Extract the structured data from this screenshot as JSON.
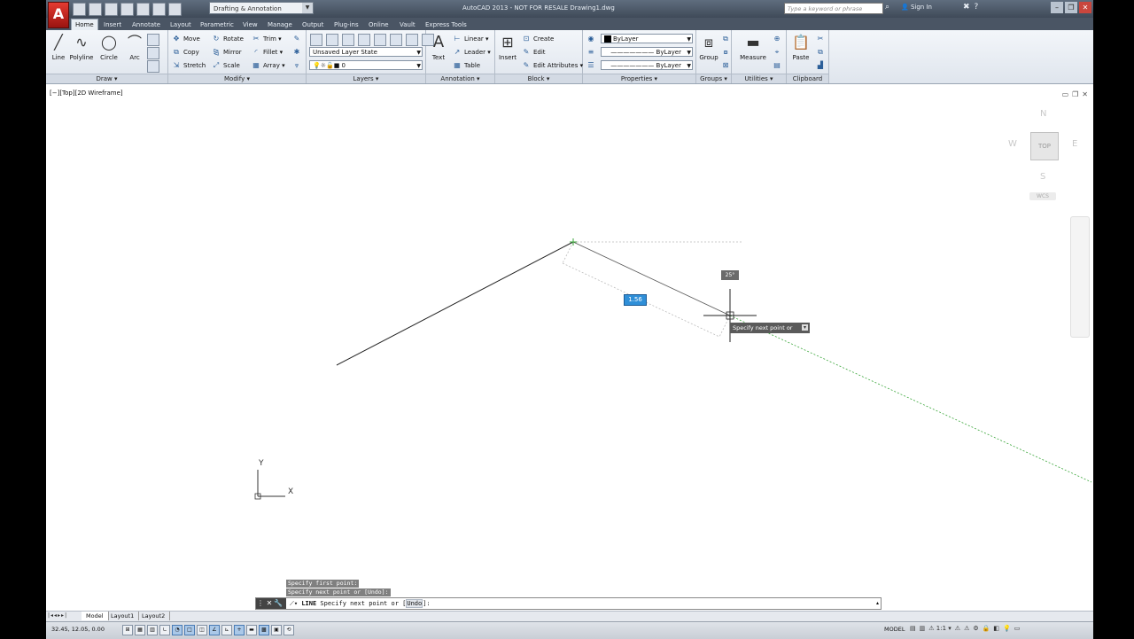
{
  "app": {
    "logo_letter": "A",
    "title": "AutoCAD 2013 - NOT FOR RESALE     Drawing1.dwg",
    "workspace": "Drafting & Annotation",
    "search_placeholder": "Type a keyword or phrase",
    "signin": "Sign In"
  },
  "tabs": [
    "Home",
    "Insert",
    "Annotate",
    "Layout",
    "Parametric",
    "View",
    "Manage",
    "Output",
    "Plug-ins",
    "Online",
    "Vault",
    "Express Tools"
  ],
  "ribbon": {
    "draw": {
      "title": "Draw",
      "line": "Line",
      "polyline": "Polyline",
      "circle": "Circle",
      "arc": "Arc"
    },
    "modify": {
      "title": "Modify",
      "move": "Move",
      "rotate": "Rotate",
      "trim": "Trim",
      "copy": "Copy",
      "mirror": "Mirror",
      "fillet": "Fillet",
      "stretch": "Stretch",
      "scale": "Scale",
      "array": "Array"
    },
    "layers": {
      "title": "Layers",
      "layer_state": "Unsaved Layer State",
      "current_layer": "0"
    },
    "annotation": {
      "title": "Annotation",
      "text": "Text",
      "linear": "Linear",
      "leader": "Leader",
      "table": "Table"
    },
    "block": {
      "title": "Block",
      "insert": "Insert",
      "create": "Create",
      "edit": "Edit",
      "edit_attributes": "Edit Attributes"
    },
    "properties": {
      "title": "Properties",
      "color": "ByLayer",
      "linetype": "ByLayer",
      "lineweight": "ByLayer"
    },
    "groups": {
      "title": "Groups",
      "group": "Group"
    },
    "utilities": {
      "title": "Utilities",
      "measure": "Measure"
    },
    "clipboard": {
      "title": "Clipboard",
      "paste": "Paste"
    }
  },
  "viewport": {
    "label": "[−][Top][2D Wireframe]",
    "viewcube": {
      "top": "TOP",
      "north": "N",
      "south": "S",
      "east": "E",
      "west": "W",
      "wcs": "WCS"
    },
    "dynamic_input_value": "1.56",
    "angle_value": "25°",
    "tooltip": "Specify next point or",
    "ucs_x": "X",
    "ucs_y": "Y"
  },
  "command": {
    "history": [
      "Specify first point:",
      "Specify next point or [Undo]:"
    ],
    "prompt_cmd": "LINE",
    "prompt_text": " Specify next point or [",
    "prompt_option": "Undo",
    "prompt_end": "]:"
  },
  "layout_tabs": [
    "Model",
    "Layout1",
    "Layout2"
  ],
  "status": {
    "coords": "32.45, 12.05, 0.00",
    "model": "MODEL",
    "scale": "1:1"
  },
  "colors": {
    "accent_red": "#c8241c",
    "titlebar": "#4f5b6a",
    "dynamic_input": "#2f8fd8",
    "tracking_green": "#3aa63a"
  }
}
